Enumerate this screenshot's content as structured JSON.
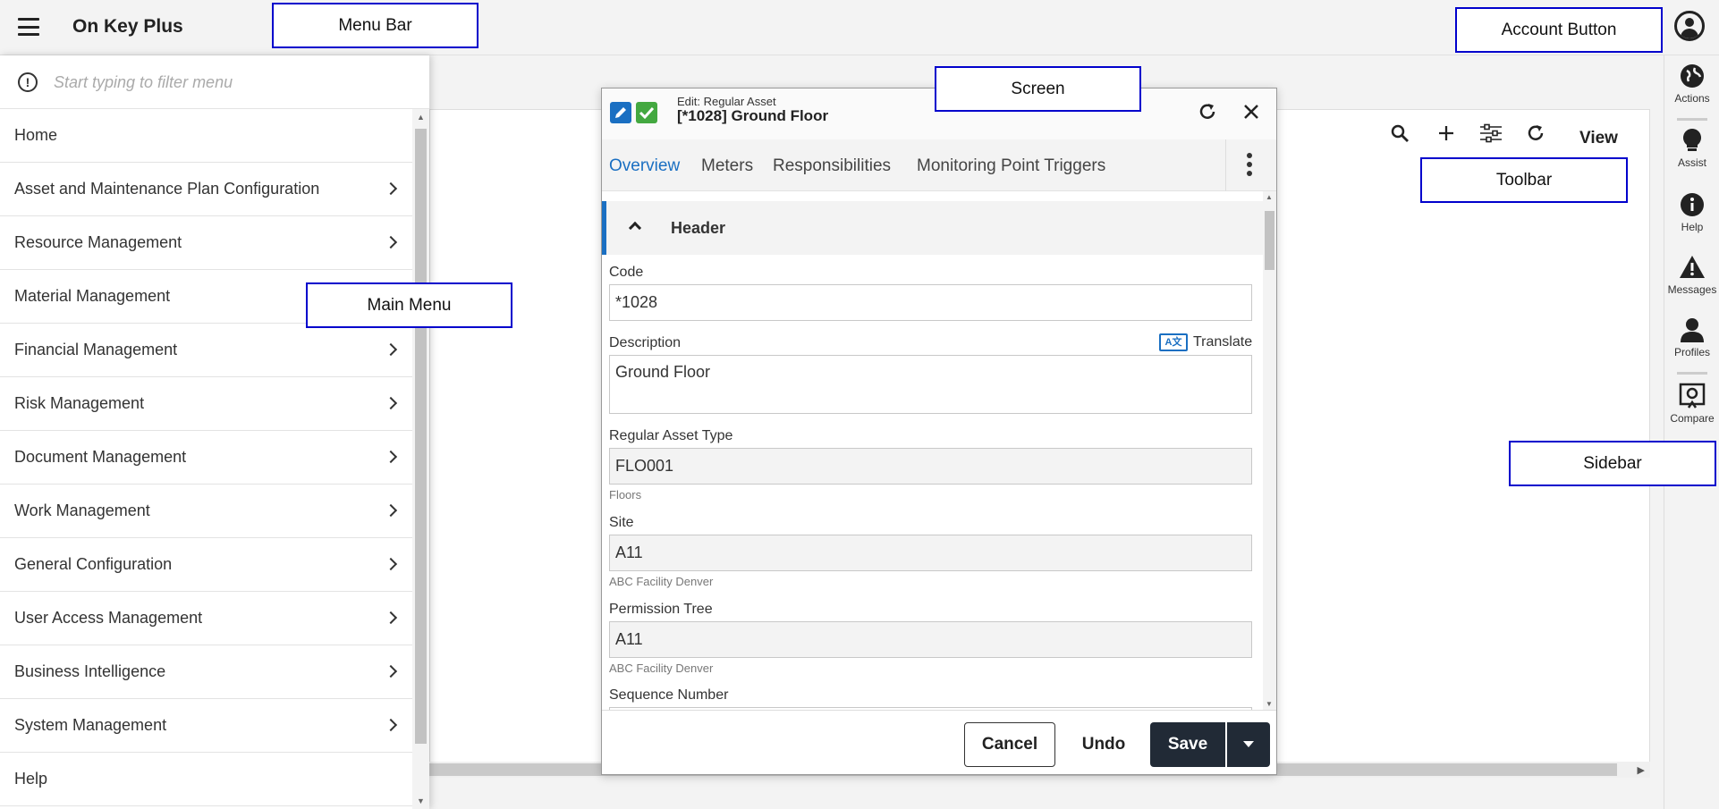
{
  "app": {
    "title": "On Key Plus"
  },
  "sidebar": {
    "items": [
      {
        "label": "Actions",
        "icon": "globe-icon"
      },
      {
        "label": "Assist",
        "icon": "lightbulb-icon"
      },
      {
        "label": "Help",
        "icon": "info-icon"
      },
      {
        "label": "Messages",
        "icon": "warning-icon"
      },
      {
        "label": "Profiles",
        "icon": "person-icon"
      },
      {
        "label": "Compare",
        "icon": "compare-icon"
      }
    ]
  },
  "toolbar": {
    "view_label": "View"
  },
  "menu": {
    "filter_placeholder": "Start typing to filter menu",
    "items": [
      {
        "label": "Home",
        "submenu": false
      },
      {
        "label": "Asset and Maintenance Plan Configuration",
        "submenu": true
      },
      {
        "label": "Resource Management",
        "submenu": true
      },
      {
        "label": "Material Management",
        "submenu": true
      },
      {
        "label": "Financial Management",
        "submenu": true
      },
      {
        "label": "Risk Management",
        "submenu": true
      },
      {
        "label": "Document Management",
        "submenu": true
      },
      {
        "label": "Work Management",
        "submenu": true
      },
      {
        "label": "General Configuration",
        "submenu": true
      },
      {
        "label": "User Access Management",
        "submenu": true
      },
      {
        "label": "Business Intelligence",
        "submenu": true
      },
      {
        "label": "System Management",
        "submenu": true
      },
      {
        "label": "Help",
        "submenu": false
      }
    ]
  },
  "dialog": {
    "subtitle": "Edit: Regular Asset",
    "title": "[*1028] Ground Floor",
    "tabs": [
      {
        "label": "Overview",
        "active": true
      },
      {
        "label": "Meters",
        "active": false
      },
      {
        "label": "Responsibilities",
        "active": false
      },
      {
        "label": "Monitoring Point Triggers",
        "active": false
      }
    ],
    "section": {
      "title": "Header"
    },
    "fields": {
      "code": {
        "label": "Code",
        "value": "*1028"
      },
      "description": {
        "label": "Description",
        "value": "Ground Floor",
        "translate_label": "Translate"
      },
      "asset_type": {
        "label": "Regular Asset Type",
        "value": "FLO001",
        "hint": "Floors"
      },
      "site": {
        "label": "Site",
        "value": "A11",
        "hint": "ABC Facility Denver"
      },
      "permission_tree": {
        "label": "Permission Tree",
        "value": "A11",
        "hint": "ABC Facility Denver"
      },
      "sequence": {
        "label": "Sequence Number"
      }
    },
    "footer": {
      "cancel": "Cancel",
      "undo": "Undo",
      "save": "Save"
    }
  },
  "annotations": {
    "menu_bar": "Menu Bar",
    "account_button": "Account Button",
    "screen": "Screen",
    "toolbar": "Toolbar",
    "main_menu": "Main Menu",
    "sidebar": "Sidebar"
  },
  "colors": {
    "accent": "#1a6fc2",
    "success": "#43a840",
    "save_button": "#212a36",
    "callout_border": "#0000cc"
  }
}
